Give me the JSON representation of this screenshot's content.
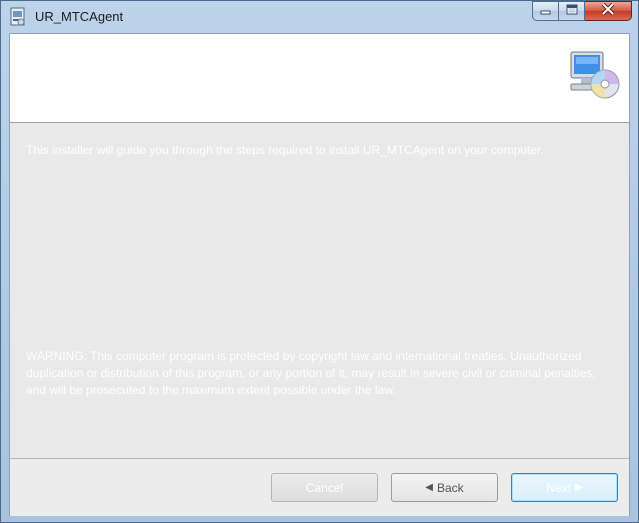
{
  "window": {
    "title": "UR_MTCAgent",
    "icon": "installer-icon",
    "controls": {
      "minimize": "minimize-icon",
      "maximize": "maximize-icon",
      "close": "close-icon"
    }
  },
  "banner": {
    "image": "computer-with-cd-icon"
  },
  "content": {
    "intro": "This installer will guide you through the steps required to install UR_MTCAgent on your computer.",
    "warning": "WARNING: This computer program is protected by copyright law and international treaties. Unauthorized duplication or distribution of this program, or any portion of it, may result in severe civil or criminal penalties, and will be prosecuted to the maximum extent possible under the law."
  },
  "buttons": {
    "cancel": "Cancel",
    "back": "Back",
    "next": "Next"
  },
  "colors": {
    "titlebar": "#bcd3ea",
    "close_button": "#c33a25",
    "body_bg": "#e9e9e9"
  }
}
